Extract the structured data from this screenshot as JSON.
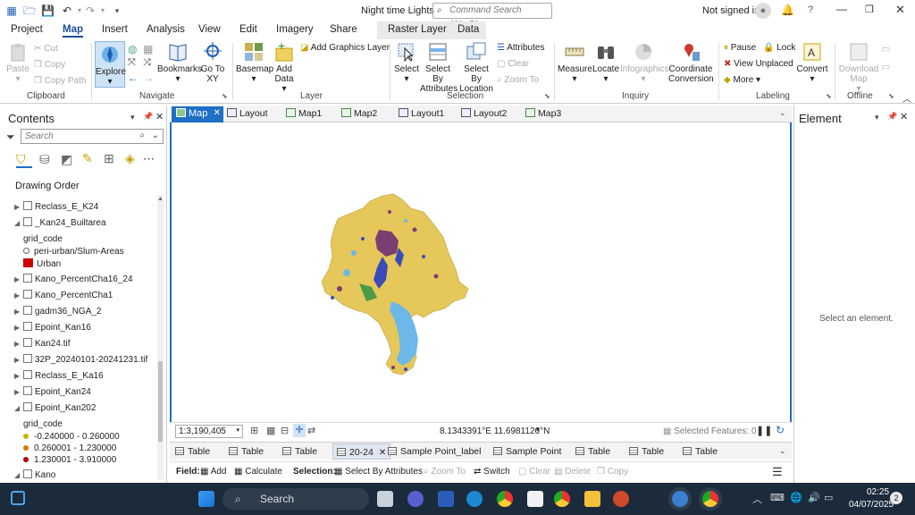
{
  "app": {
    "title": "Night time Lights",
    "signed_in": "Not signed in",
    "search_placeholder": "Command Search (Alt+Q)"
  },
  "ribbon_tabs": [
    "Project",
    "Map",
    "Insert",
    "Analysis",
    "View",
    "Edit",
    "Imagery",
    "Share",
    "Raster Layer",
    "Data"
  ],
  "ribbon": {
    "clipboard": {
      "label": "Clipboard",
      "paste": "Paste",
      "cut": "Cut",
      "copy": "Copy",
      "copy_path": "Copy Path"
    },
    "navigate": {
      "label": "Navigate",
      "explore": "Explore",
      "bookmarks": "Bookmarks",
      "goto": "Go To XY"
    },
    "layer": {
      "label": "Layer",
      "basemap": "Basemap",
      "add_data": "Add Data",
      "add_graphics": "Add Graphics Layer"
    },
    "selection": {
      "label": "Selection",
      "select": "Select",
      "select_by_attr": "Select By Attributes",
      "select_by_loc": "Select By Location",
      "attributes": "Attributes",
      "clear": "Clear",
      "zoom_to": "Zoom To"
    },
    "inquiry": {
      "label": "Inquiry",
      "measure": "Measure",
      "locate": "Locate",
      "infographics": "Infographics",
      "coord_conv": "Coordinate Conversion"
    },
    "labeling": {
      "label": "Labeling",
      "pause": "Pause",
      "lock": "Lock",
      "view_unplaced": "View Unplaced",
      "more": "More",
      "convert": "Convert"
    },
    "offline": {
      "label": "Offline",
      "download": "Download Map"
    }
  },
  "contents": {
    "title": "Contents",
    "search_placeholder": "Search",
    "drawing_order": "Drawing Order",
    "layers": [
      {
        "name": "Reclass_E_K24",
        "expanded": false
      },
      {
        "name": "_Kan24_Builtarea",
        "expanded": true
      },
      {
        "name": "grid_code",
        "kind": "sub"
      },
      {
        "name": "peri-urban/Slum-Areas",
        "kind": "legend"
      },
      {
        "name": "Urban",
        "kind": "legend"
      },
      {
        "name": "Kano_PercentCha16_24",
        "expanded": false
      },
      {
        "name": "Kano_PercentCha1",
        "expanded": false
      },
      {
        "name": "gadm36_NGA_2",
        "expanded": false
      },
      {
        "name": "Epoint_Kan16",
        "expanded": false
      },
      {
        "name": "Kan24.tif",
        "expanded": false
      },
      {
        "name": "32P_20240101-20241231.tif",
        "expanded": false
      },
      {
        "name": "Reclass_E_Ka16",
        "expanded": false
      },
      {
        "name": "Epoint_Kan24",
        "expanded": false
      },
      {
        "name": "Epoint_Kan202",
        "expanded": true
      },
      {
        "name": "grid_code",
        "kind": "sub"
      },
      {
        "name": "-0.240000 - 0.260000",
        "kind": "legend"
      },
      {
        "name": "0.260001 - 1.230000",
        "kind": "legend"
      },
      {
        "name": "1.230001 - 3.910000",
        "kind": "legend"
      },
      {
        "name": "Kano",
        "expanded": true
      }
    ],
    "legend_colors": {
      "peri": "#ffffff",
      "urban": "#cc0000",
      "c1": "#c8b800",
      "c2": "#d97a00",
      "c3": "#b00000"
    }
  },
  "map_tabs": [
    "Map",
    "Layout",
    "Map1",
    "Map2",
    "Layout1",
    "Layout2",
    "Map3"
  ],
  "status": {
    "scale": "1:3,190,405",
    "coords": "8.1343391°E 11.6981126°N",
    "selected": "Selected Features: 0"
  },
  "bottom_tabs": [
    "Table",
    "Table",
    "Table",
    "20-24",
    "Sample Point_label",
    "Sample Point",
    "Table",
    "Table",
    "Table"
  ],
  "field_bar": {
    "field": "Field:",
    "add": "Add",
    "calculate": "Calculate",
    "selection": "Selection:",
    "select_by_attr": "Select By Attributes",
    "zoom_to": "Zoom To",
    "switch": "Switch",
    "clear": "Clear",
    "delete": "Delete",
    "copy": "Copy"
  },
  "element_pane": {
    "title": "Element",
    "message": "Select an element."
  },
  "taskbar": {
    "search": "Search",
    "time": "02:25",
    "date": "04/07/2025",
    "notif": "2"
  }
}
